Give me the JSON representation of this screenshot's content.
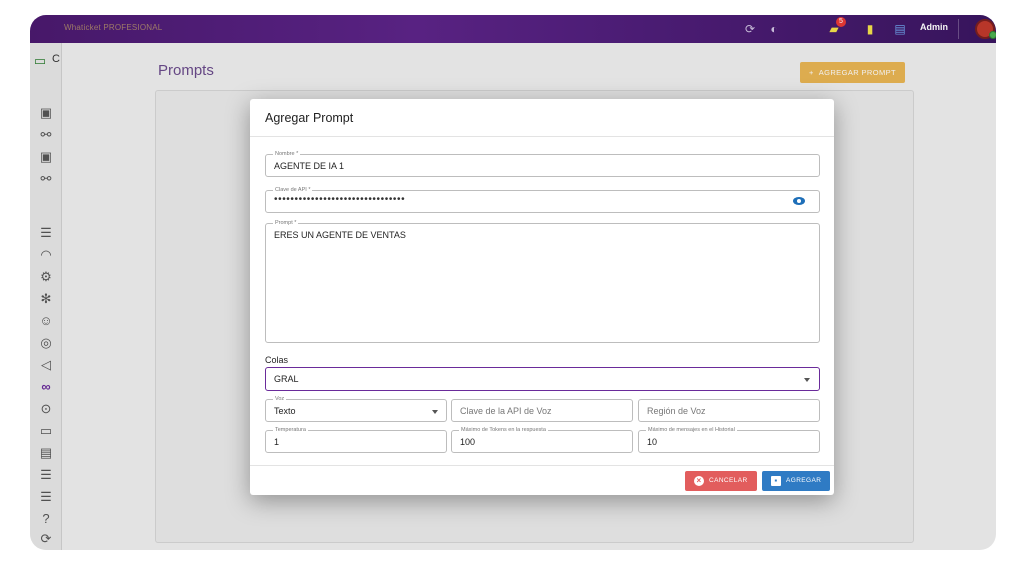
{
  "topbar": {
    "app_name": "Whaticket PROFESIONAL",
    "notification_count": "5",
    "user_name": "Admin"
  },
  "sidebar": {
    "top_label": "C"
  },
  "main": {
    "title": "Prompts",
    "add_button_label": "AGREGAR PROMPT"
  },
  "dialog": {
    "title": "Agregar Prompt",
    "nombre": {
      "label": "Nombre *",
      "value": "AGENTE DE IA 1"
    },
    "api_key": {
      "label": "Clave de API *",
      "value": "••••••••••••••••••••••••••••••••"
    },
    "prompt": {
      "label": "Prompt *",
      "value": "ERES UN AGENTE DE VENTAS"
    },
    "colas": {
      "label": "Colas",
      "value": "GRAL"
    },
    "voz": {
      "label": "Voz",
      "value": "Texto"
    },
    "voice_api_key": {
      "placeholder": "Clave de la API de Voz"
    },
    "voice_region": {
      "placeholder": "Región de Voz"
    },
    "temperatura": {
      "label": "Temperatura",
      "value": "1"
    },
    "max_tokens": {
      "label": "Máximo de Tokens en la respuesta",
      "value": "100"
    },
    "max_history": {
      "label": "Máximo de mensajes en el Historial",
      "value": "10"
    },
    "cancel_label": "CANCELAR",
    "add_label": "AGREGAR"
  },
  "colors": {
    "topbar": "#4a1a6e",
    "accent_purple": "#6a2b9a",
    "add_prompt_orange": "#e6a020",
    "cancel_red": "#e25d5d",
    "add_blue": "#2f7bc4"
  }
}
